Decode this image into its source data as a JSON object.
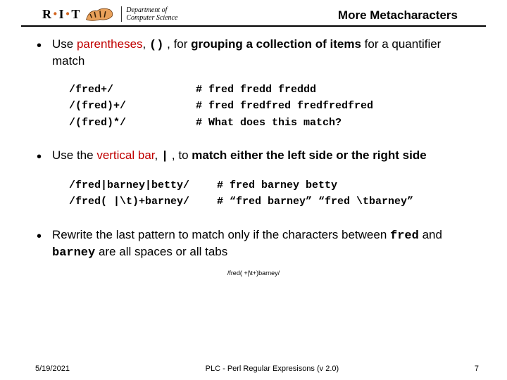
{
  "header": {
    "logo_text_R": "R",
    "logo_text_I": "I",
    "logo_text_T": "T",
    "dept_line1": "Department of",
    "dept_line2": "Computer Science",
    "title": "More Metacharacters"
  },
  "bullets": {
    "b1_pre": "Use ",
    "b1_red": "parentheses",
    "b1_comma": ", ",
    "b1_code": "()",
    "b1_post": " , for ",
    "b1_bold": "grouping a collection of items",
    "b1_tail": " for a quantifier match",
    "b2_pre": "Use the ",
    "b2_red": "vertical bar",
    "b2_comma": ", ",
    "b2_code": "|",
    "b2_post": " , to ",
    "b2_bold": "match either the left side or the right side",
    "b3": "Rewrite the last pattern to match only if the characters between ",
    "b3_code1": "fred",
    "b3_mid": " and ",
    "b3_code2": "barney",
    "b3_tail": " are all spaces or all tabs"
  },
  "code1": {
    "rows": [
      {
        "l": "/fred+/",
        "r": "# fred fredd freddd"
      },
      {
        "l": "/(fred)+/",
        "r": "# fred fredfred fredfredfred"
      },
      {
        "l": "/(fred)*/",
        "r": "# What does this match?"
      }
    ]
  },
  "code2": {
    "rows": [
      {
        "l": "/fred|barney|betty/",
        "r": "# fred barney betty"
      },
      {
        "l": "/fred( |\\t)+barney/",
        "r": "# “fred barney” “fred \\tbarney”"
      }
    ]
  },
  "answer": "/fred( +|\\t+)barney/",
  "footer": {
    "left": "5/19/2021",
    "center": "PLC - Perl Regular Expresisons  (v 2.0)",
    "right": "7"
  }
}
